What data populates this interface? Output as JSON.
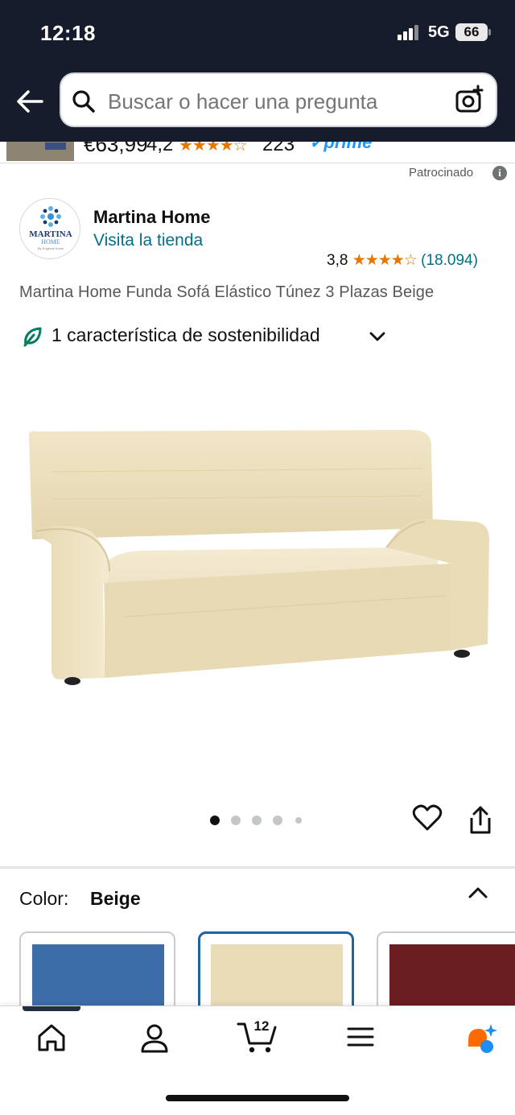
{
  "status_bar": {
    "time": "12:18",
    "network": "5G",
    "battery": "66"
  },
  "search": {
    "placeholder": "Buscar o hacer una pregunta"
  },
  "prev_product": {
    "price": "€63,99",
    "rating": "4,2",
    "stars": "★★★★☆",
    "reviews": "223",
    "prime": "✓prime"
  },
  "sponsored": {
    "label": "Patrocinado",
    "info_glyph": "i"
  },
  "brand": {
    "logo_word": "MARTINA",
    "logo_sub": "HOME",
    "logo_tag": "By Eugenia Home",
    "name": "Martina Home",
    "store_link": "Visita la tienda"
  },
  "rating": {
    "value": "3,8",
    "stars": "★★★★☆",
    "count": "(18.094)",
    "fraction": 0.76
  },
  "product": {
    "title": "Martina Home Funda Sofá Elástico Túnez 3 Plazas Beige"
  },
  "sustainability": {
    "label": "1 característica de sostenibilidad"
  },
  "carousel": {
    "total": 5,
    "active": 0
  },
  "color": {
    "label": "Color:",
    "value": "Beige"
  },
  "swatches": [
    {
      "name": "Azul",
      "color": "#3d6da8",
      "selected": false
    },
    {
      "name": "Beige",
      "color": "#ebdcb8",
      "selected": true
    },
    {
      "name": "Burdeos",
      "color": "#6b1e22",
      "selected": false
    }
  ],
  "bottom_nav": {
    "cart_count": "12",
    "items": [
      "home-icon",
      "user-icon",
      "cart-icon",
      "menu-icon",
      "assistant-icon"
    ]
  },
  "colors": {
    "header_bg": "#161c2c",
    "link": "#007185",
    "star": "#e77600",
    "selected_border": "#2162a1"
  }
}
